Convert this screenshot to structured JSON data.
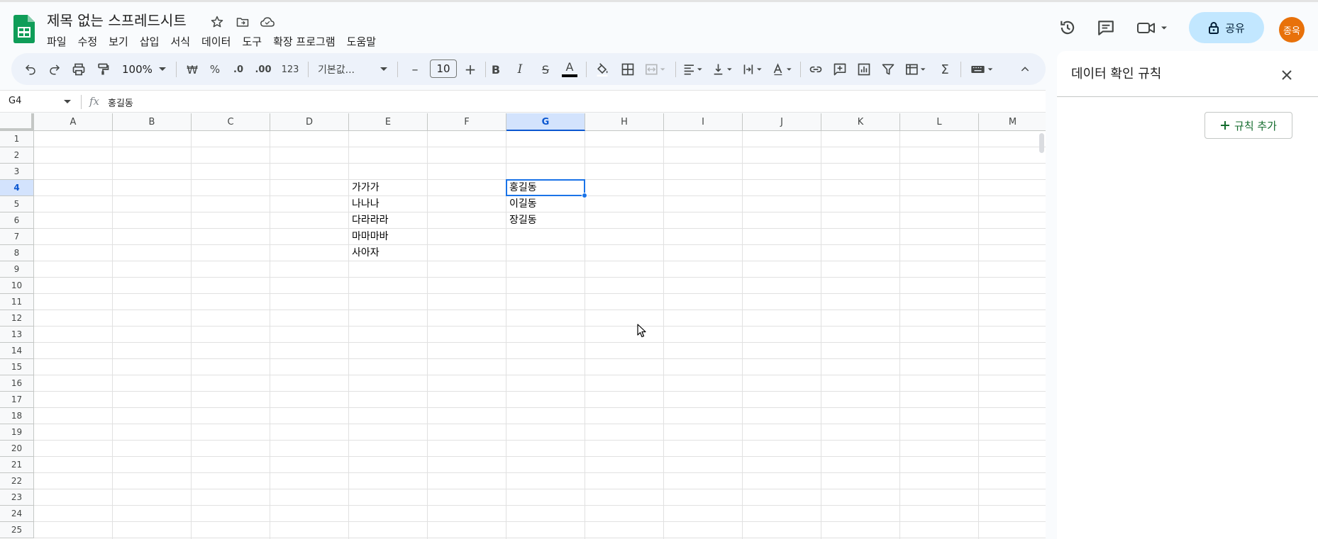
{
  "header": {
    "doc_title": "제목 없는 스프레드시트",
    "menu": [
      "파일",
      "수정",
      "보기",
      "삽입",
      "서식",
      "데이터",
      "도구",
      "확장 프로그램",
      "도움말"
    ],
    "share_label": "공유",
    "avatar_label": "종욱"
  },
  "toolbar": {
    "zoom": "100%",
    "currency_label": "₩",
    "percent_label": "%",
    "decimal_decrease_label": ".0",
    "decimal_increase_label": ".00",
    "number_format_label": "123",
    "font_label": "기본값...",
    "font_size": "10",
    "minus_label": "–",
    "plus_label": "+",
    "bold_label": "B",
    "italic_label": "I",
    "strike_label": "S",
    "text_color_label": "A",
    "sum_label": "Σ"
  },
  "formula_bar": {
    "name_box": "G4",
    "fx_label": "fx",
    "value": "홍길동"
  },
  "grid": {
    "columns": [
      "A",
      "B",
      "C",
      "D",
      "E",
      "F",
      "G",
      "H",
      "I",
      "J",
      "K",
      "L",
      "M"
    ],
    "rows": [
      "1",
      "2",
      "3",
      "4",
      "5",
      "6",
      "7",
      "8",
      "9",
      "10",
      "11",
      "12",
      "13",
      "14",
      "15",
      "16",
      "17",
      "18",
      "19",
      "20",
      "21",
      "22",
      "23",
      "24",
      "25"
    ],
    "selected_column": "G",
    "selected_row": "4",
    "cells": {
      "E4": "가가가",
      "E5": "나나나",
      "E6": "다라라라",
      "E7": "마마마바",
      "E8": "사아자",
      "G4": "홍길동",
      "G5": "이길동",
      "G6": "장길동"
    }
  },
  "side_panel": {
    "title": "데이터 확인 규칙",
    "add_rule_label": "규칙 추가"
  },
  "colors": {
    "accent": "#1a73e8",
    "share_bg": "#c2e7ff",
    "avatar_bg": "#e8710a",
    "sheets_green": "#0f9d58",
    "add_rule_text": "#146c2e"
  }
}
